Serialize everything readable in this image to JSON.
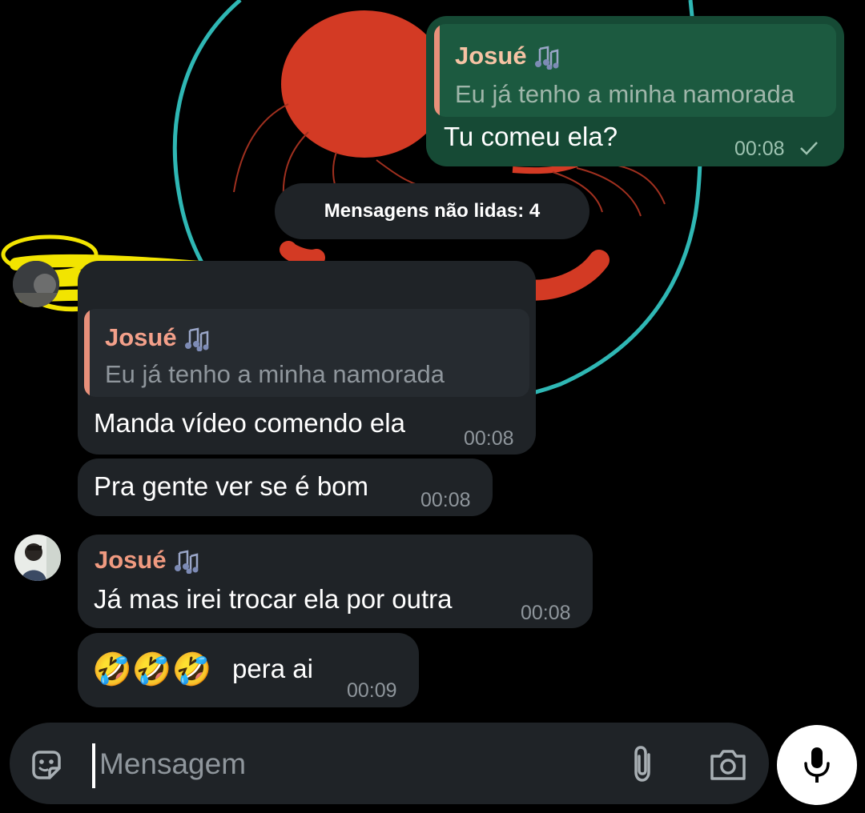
{
  "chat": {
    "outgoing_reply": {
      "quote_sender": "Josué",
      "quote_text": "Eu já tenho a minha namorada",
      "text": "Tu comeu ela?",
      "time": "00:08"
    },
    "unread_divider": "Mensagens não lidas: 4",
    "incoming_group_1": [
      {
        "quote_sender": "Josué",
        "quote_text": "Eu já tenho a minha namorada",
        "text": "Manda vídeo comendo ela",
        "time": "00:08"
      },
      {
        "text": "Pra gente ver se é bom",
        "time": "00:08"
      }
    ],
    "incoming_group_2": {
      "sender": "Josué",
      "messages": [
        {
          "text": "Já mas irei trocar ela por outra",
          "time": "00:08"
        },
        {
          "emoji": "🤣🤣🤣",
          "text": "pera ai",
          "time": "00:09"
        }
      ]
    }
  },
  "composer": {
    "placeholder": "Mensagem",
    "icons": [
      "sticker-icon",
      "attach-icon",
      "camera-icon",
      "microphone-icon"
    ]
  },
  "colors": {
    "background": "#000000",
    "incoming_bubble": "#1f2327",
    "outgoing_bubble": "#164a35",
    "sender_name": "#f09a80",
    "wallpaper_circle": "#2fb7b4",
    "wallpaper_red": "#d33a24"
  }
}
